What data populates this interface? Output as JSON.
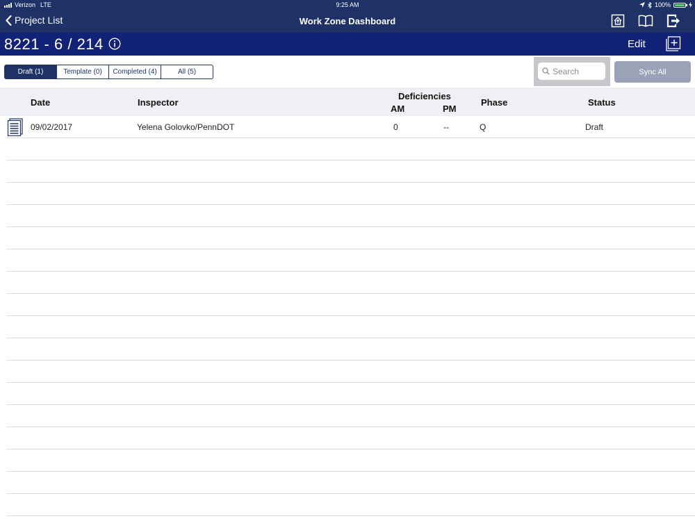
{
  "status_bar": {
    "carrier": "Verizon",
    "network": "LTE",
    "time": "9:25 AM",
    "battery": "100%"
  },
  "nav": {
    "back_label": "Project List",
    "title": "Work Zone Dashboard",
    "icons": [
      "home-sync-icon",
      "book-icon",
      "logout-icon"
    ]
  },
  "project": {
    "title": "8221 - 6 / 214",
    "edit_label": "Edit"
  },
  "filters": {
    "tabs": [
      {
        "label": "Draft (1)",
        "selected": true
      },
      {
        "label": "Template (0)",
        "selected": false
      },
      {
        "label": "Completed (4)",
        "selected": false
      },
      {
        "label": "All (5)",
        "selected": false
      }
    ]
  },
  "search": {
    "placeholder": "Search",
    "value": ""
  },
  "sync_label": "Sync All",
  "table": {
    "headers": {
      "date": "Date",
      "inspector": "Inspector",
      "deficiencies": "Deficiencies",
      "am": "AM",
      "pm": "PM",
      "phase": "Phase",
      "status": "Status"
    },
    "rows": [
      {
        "date": "09/02/2017",
        "inspector": "Yelena Golovko/PennDOT",
        "am": "0",
        "pm": "--",
        "phase": "Q",
        "status": "Draft"
      }
    ]
  },
  "colors": {
    "nav_bg": "#1e3268",
    "project_bar_bg": "#122277",
    "header_bg": "#efeff4",
    "sync_button_bg": "#9aa3b6"
  }
}
